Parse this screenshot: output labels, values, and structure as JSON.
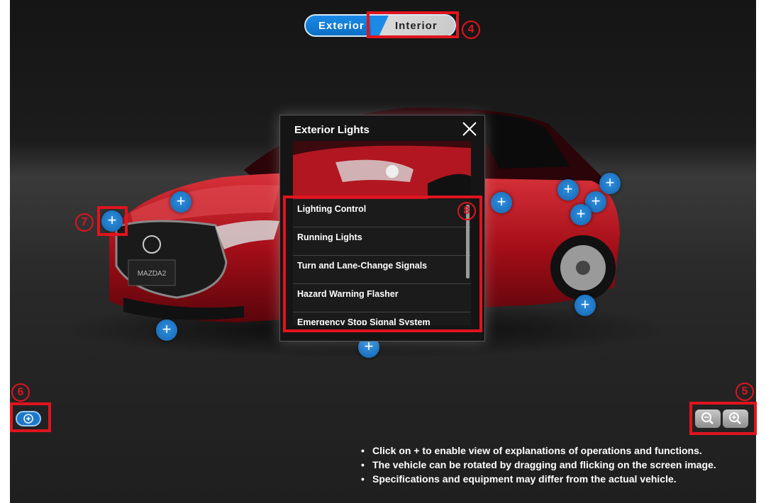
{
  "view_toggle": {
    "exterior_label": "Exterior",
    "interior_label": "Interior",
    "active": "Interior"
  },
  "annotations": {
    "m4": "4",
    "m5": "5",
    "m6": "6",
    "m7": "7",
    "m8": "8"
  },
  "car": {
    "plate_text": "MAZDA2",
    "body_color": "#b4121c"
  },
  "hotspot_symbol": "+",
  "popup": {
    "title": "Exterior Lights",
    "close_icon": "close-icon",
    "items": [
      "Lighting Control",
      "Running Lights",
      "Turn and Lane-Change Signals",
      "Hazard Warning Flasher",
      "Emergency Stop Signal System"
    ]
  },
  "controls": {
    "toggle_hotspots_icon": "plus-circle-icon",
    "zoom_out_icon": "zoom-out-icon",
    "zoom_in_icon": "zoom-in-icon"
  },
  "notes": [
    "Click on + to enable view of explanations of operations and functions.",
    "The vehicle can be rotated by dragging and flicking on the screen image.",
    "Specifications and equipment may differ from the actual vehicle."
  ],
  "colors": {
    "accent_blue": "#1a8ae6",
    "annotation_red": "#e0141e"
  }
}
